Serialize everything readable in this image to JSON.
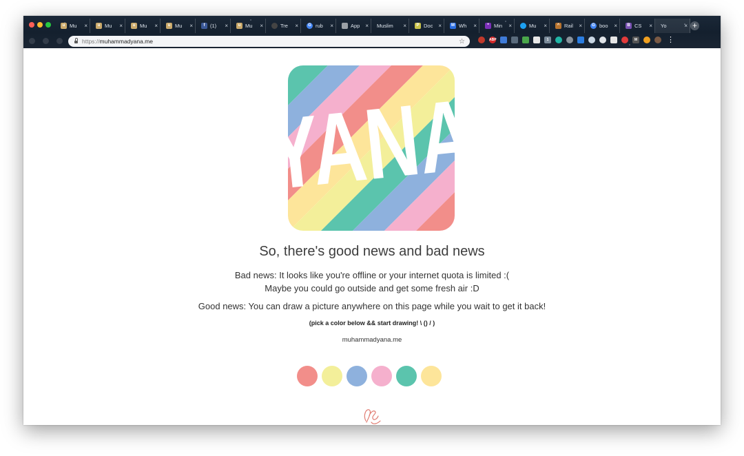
{
  "browser": {
    "tabs": [
      {
        "title": "Mu",
        "favicon": "u",
        "favicon_color": "#caa96a",
        "active": false
      },
      {
        "title": "Mu",
        "favicon": "u",
        "favicon_color": "#caa96a",
        "active": false
      },
      {
        "title": "Mu",
        "favicon": "u",
        "favicon_color": "#caa96a",
        "active": false
      },
      {
        "title": "Mu",
        "favicon": "u",
        "favicon_color": "#caa96a",
        "active": false
      },
      {
        "title": "(1)",
        "favicon": "f",
        "favicon_color": "#3b5998",
        "active": false
      },
      {
        "title": "Mu",
        "favicon": "u",
        "favicon_color": "#caa96a",
        "active": false
      },
      {
        "title": "Tre",
        "favicon": "github",
        "favicon_color": "#444444",
        "active": false
      },
      {
        "title": "rub",
        "favicon": "G",
        "favicon_color": "#4285f4",
        "active": false
      },
      {
        "title": "App",
        "favicon": "doc",
        "favicon_color": "#9aa0a6",
        "active": false
      },
      {
        "title": "Muslim",
        "favicon": "",
        "favicon_color": "",
        "active": false
      },
      {
        "title": "Doc",
        "favicon": "P",
        "favicon_color": "#c9c24a",
        "active": false
      },
      {
        "title": "Wh",
        "favicon": "M",
        "favicon_color": "#2b6de0",
        "active": false
      },
      {
        "title": "Min",
        "favicon": "*",
        "favicon_color": "#7b2fb8",
        "active": false
      },
      {
        "title": "Mu",
        "favicon": "bird",
        "favicon_color": "#1da1f2",
        "active": false
      },
      {
        "title": "Rail",
        "favicon": "^",
        "favicon_color": "#b8742f",
        "active": false
      },
      {
        "title": "boo",
        "favicon": "G",
        "favicon_color": "#4285f4",
        "active": false
      },
      {
        "title": "CS",
        "favicon": "B",
        "favicon_color": "#7952b3",
        "active": false
      },
      {
        "title": "Yo",
        "favicon": "",
        "favicon_color": "",
        "active": true
      }
    ],
    "close_glyph": "×",
    "new_tab_glyph": "+",
    "url_scheme": "https://",
    "url_host": "muhammadyana.me",
    "extensions": [
      {
        "label": "",
        "color": "#c0392b",
        "round": true
      },
      {
        "label": "ABP",
        "color": "#d62a2a",
        "round": true
      },
      {
        "label": "",
        "color": "#3f7bd8",
        "round": false
      },
      {
        "label": "",
        "color": "#5a6b7c",
        "round": false
      },
      {
        "label": "",
        "color": "#4aa64a",
        "round": false
      },
      {
        "label": "",
        "color": "#e8e8e8",
        "round": false
      },
      {
        "label": "1",
        "color": "#7a8a99",
        "round": false
      },
      {
        "label": "",
        "color": "#20b5a5",
        "round": true
      },
      {
        "label": "",
        "color": "#8a939c",
        "round": true
      },
      {
        "label": "",
        "color": "#2b7de0",
        "round": false
      },
      {
        "label": "",
        "color": "#c9d6e3",
        "round": true
      },
      {
        "label": "",
        "color": "#e0e4e8",
        "round": true
      },
      {
        "label": "",
        "color": "#e6e6e6",
        "round": false
      },
      {
        "label": "",
        "color": "#e23b3b",
        "round": true
      },
      {
        "label": "M",
        "color": "#555555",
        "round": false
      },
      {
        "label": "",
        "color": "#f0a020",
        "round": true
      },
      {
        "label": "",
        "color": "#7a5a45",
        "round": true
      }
    ],
    "menu_glyph": "⋮"
  },
  "logo": {
    "text": "YANA",
    "stripe_colors": [
      "#f28e8a",
      "#fde59a",
      "#f3ef9a",
      "#5bc4ad",
      "#8eb1dd",
      "#f5b0cd"
    ]
  },
  "content": {
    "headline": "So, there's good news and bad news",
    "bad_news_line1": "Bad news: It looks like you're offline or your internet quota is limited :(",
    "bad_news_line2": "Maybe you could go outside and get some fresh air :D",
    "good_news": "Good news: You can draw a picture anywhere on this page while you wait to get it back!",
    "hint": "(pick a color below && start drawing! \\ () / )",
    "site_name": "muhammadyana.me"
  },
  "palette": [
    {
      "name": "red",
      "color": "#f28e8a"
    },
    {
      "name": "yellow",
      "color": "#f3ef9a"
    },
    {
      "name": "blue",
      "color": "#8eb1dd"
    },
    {
      "name": "pink",
      "color": "#f5b0cd"
    },
    {
      "name": "teal",
      "color": "#5bc4ad"
    },
    {
      "name": "orange",
      "color": "#fde59a"
    }
  ],
  "signature_color": "#e07a70"
}
